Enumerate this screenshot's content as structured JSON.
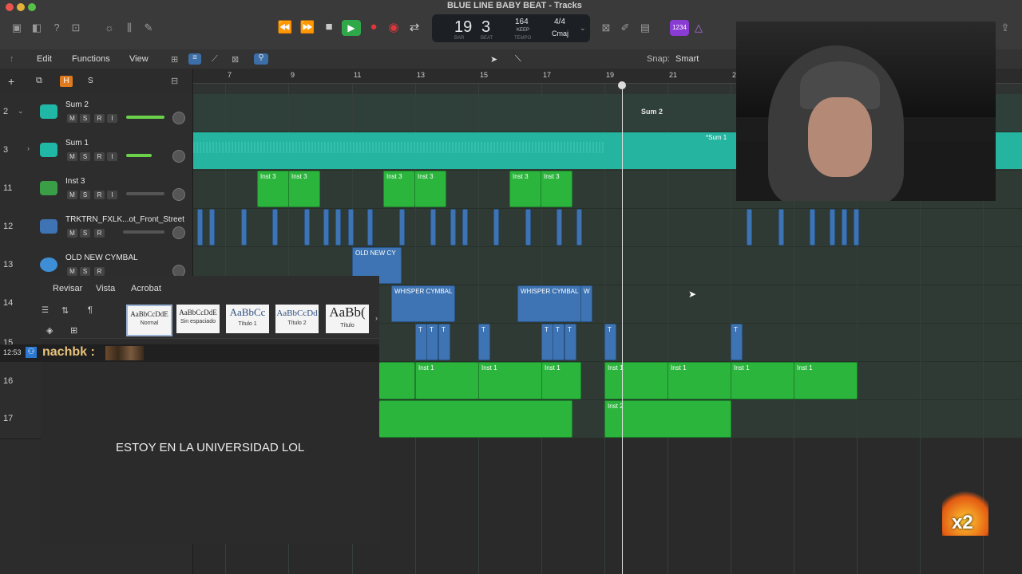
{
  "window": {
    "title": "BLUE LINE BABY BEAT - Tracks"
  },
  "lcd": {
    "bar": "19",
    "beat": "3",
    "bar_label": "BAR",
    "beat_label": "BEAT",
    "tempo": "164",
    "tempo_mode": "KEEP",
    "tempo_label": "TEMPO",
    "signature": "4/4",
    "key": "Cmaj"
  },
  "badge_1234": "1234",
  "control_bar": {
    "edit": "Edit",
    "functions": "Functions",
    "view": "View",
    "snap_label": "Snap:",
    "snap_value": "Smart"
  },
  "header_buttons": {
    "h": "H",
    "s": "S"
  },
  "ruler": [
    "7",
    "9",
    "11",
    "13",
    "15",
    "17",
    "19",
    "21",
    "2"
  ],
  "tracks": [
    {
      "num": "2",
      "name": "Sum 2"
    },
    {
      "num": "3",
      "name": "Sum 1"
    },
    {
      "num": "11",
      "name": "Inst 3"
    },
    {
      "num": "12",
      "name": "TRKTRN_FXLK...ot_Front_Street"
    },
    {
      "num": "13",
      "name": "OLD NEW CYMBAL"
    },
    {
      "num": "14",
      "name": ""
    },
    {
      "num": "15",
      "name": ""
    },
    {
      "num": "16",
      "name": ""
    },
    {
      "num": "17",
      "name": ""
    }
  ],
  "mute": "M",
  "solo": "S",
  "record": "R",
  "input": "I",
  "regions": {
    "sum2": "Sum 2",
    "sum1": "*Sum 1",
    "inst3": "Inst 3",
    "cymbal": "OLD NEW CY",
    "whisper": "WHISPER CYMBAL",
    "whisper_short": "W",
    "t": "T",
    "inst1": "Inst 1",
    "inst2": "Inst 2"
  },
  "word": {
    "tabs": [
      "Revisar",
      "Vista",
      "Acrobat"
    ],
    "styles": [
      {
        "preview": "AaBbCcDdE",
        "name": "Normal"
      },
      {
        "preview": "AaBbCcDdE",
        "name": "Sin espaciado"
      },
      {
        "preview": "AaBbCc",
        "name": "Título 1"
      },
      {
        "preview": "AaBbCcDd",
        "name": "Título 2"
      },
      {
        "preview": "AaBb(",
        "name": "Título"
      }
    ]
  },
  "chat": {
    "time": "12:53",
    "user": "nachbk :",
    "message": "ESTOY EN LA UNIVERSIDAD LOL"
  },
  "overlay_badge": "x2"
}
